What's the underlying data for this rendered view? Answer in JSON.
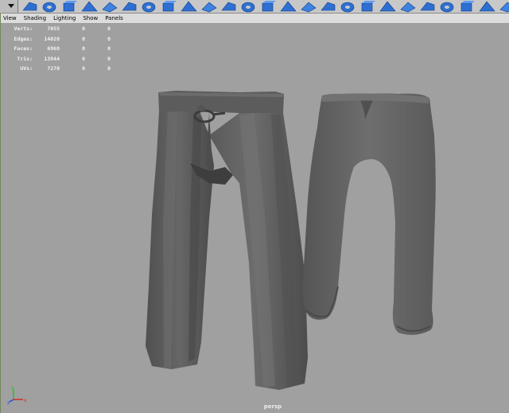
{
  "panel_menu": [
    "View",
    "Shading",
    "Lighting",
    "Show",
    "Panels"
  ],
  "hud": {
    "rows": [
      {
        "label": "Verts:",
        "v1": "7055",
        "v2": "0",
        "v3": "0"
      },
      {
        "label": "Edges:",
        "v1": "14020",
        "v2": "0",
        "v3": "0"
      },
      {
        "label": "Faces:",
        "v1": "6968",
        "v2": "0",
        "v3": "0"
      },
      {
        "label": "Tris:",
        "v1": "13944",
        "v2": "0",
        "v3": "0"
      },
      {
        "label": "UVs:",
        "v1": "7270",
        "v2": "0",
        "v3": "0"
      }
    ]
  },
  "camera_label": "persp",
  "axis": {
    "y": "y",
    "x": "x",
    "z": "z"
  },
  "colors": {
    "viewport_bg": "#a0a0a0",
    "mesh_dark": "#4f4f4f",
    "mesh_mid": "#666666",
    "shelf_blue": "#2e6fd1"
  },
  "shelf_icons": [
    "poly-cube-icon",
    "poly-cone-icon",
    "poly-torus-icon",
    "poly-plane-icon",
    "poly-sphere-icon",
    "poly-cylinder-icon",
    "poly-pipe-icon",
    "poly-helix-icon",
    "poly-prism-icon",
    "poly-pyramid-icon",
    "poly-cube-icon",
    "poly-soccer-icon",
    "poly-extrude-icon",
    "poly-bridge-icon",
    "poly-append-icon",
    "poly-split-icon",
    "poly-bevel-icon",
    "poly-merge-icon",
    "poly-smooth-icon",
    "poly-mirror-icon",
    "poly-combine-icon",
    "poly-separate-icon",
    "poly-fill-hole-icon",
    "poly-wedge-icon",
    "poly-uv-icon"
  ]
}
